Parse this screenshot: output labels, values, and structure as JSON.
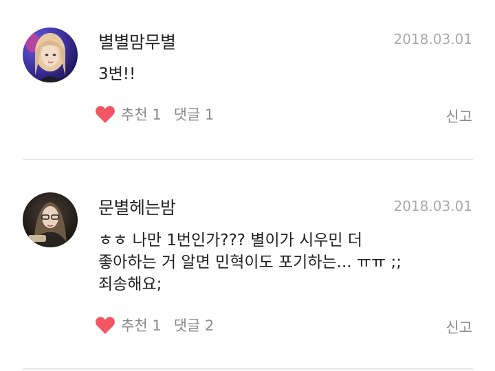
{
  "comments": [
    {
      "username": "별별맘무별",
      "date": "2018.03.01",
      "text": "3변!!",
      "like_label": "추천",
      "like_count": "1",
      "reply_label": "댓글",
      "reply_count": "1",
      "report_label": "신고"
    },
    {
      "username": "문별헤는밤",
      "date": "2018.03.01",
      "text": "ㅎㅎ 나만 1번인가??? 별이가 시우민 더\n좋아하는 거 알면 민혁이도 포기하는... ㅠㅠ  ;;\n죄송해요;",
      "like_label": "추천",
      "like_count": "1",
      "reply_label": "댓글",
      "reply_count": "2",
      "report_label": "신고"
    }
  ],
  "colors": {
    "heart": "#f25563",
    "text": "#222222",
    "muted": "#8a8a8a",
    "date": "#aaaaaa",
    "divider": "#e8e8e8"
  },
  "icons": [
    "heart-icon"
  ]
}
